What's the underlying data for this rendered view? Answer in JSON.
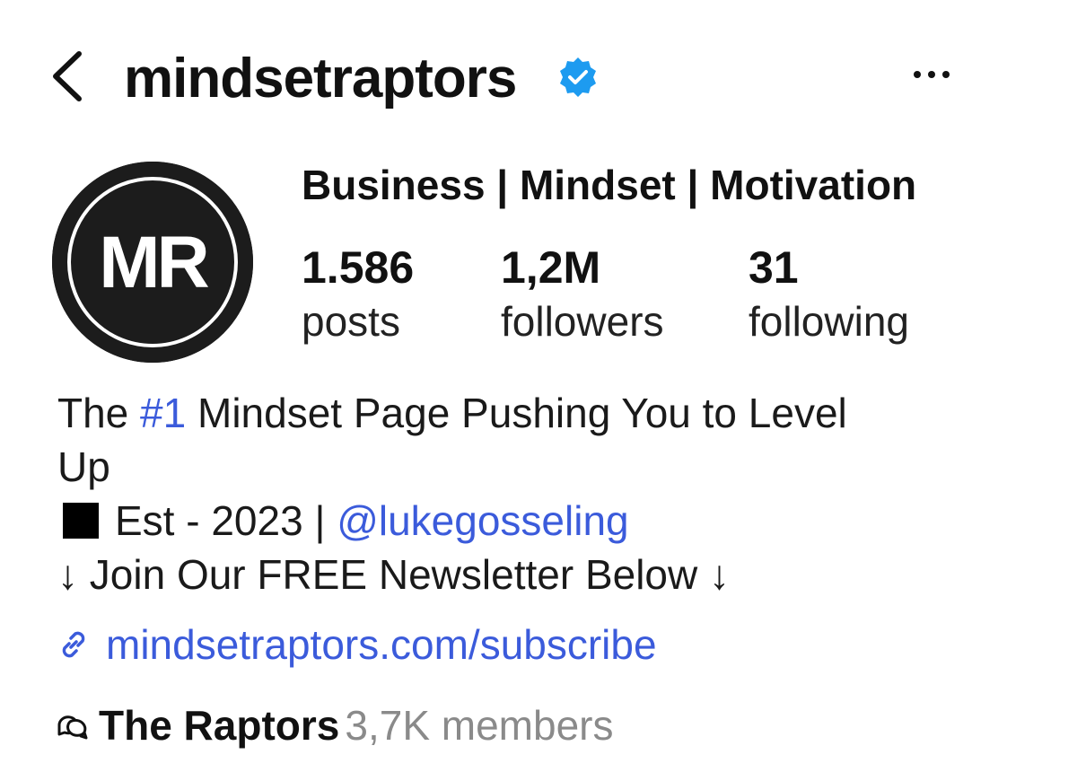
{
  "header": {
    "username": "mindsetraptors",
    "back_icon": "chevron-left-icon",
    "verified_icon": "verified-badge-icon",
    "more_icon": "more-horizontal-icon"
  },
  "profile": {
    "avatar_text": "MR",
    "category": "Business | Mindset | Motivation",
    "stats": {
      "posts": {
        "value": "1.586",
        "label": "posts"
      },
      "followers": {
        "value": "1,2M",
        "label": "followers"
      },
      "following": {
        "value": "31",
        "label": "following"
      }
    }
  },
  "bio": {
    "line1_prefix": "The ",
    "hashtag": "#1",
    "line1_suffix": " Mindset Page Pushing You to Level",
    "line2": "Up",
    "line3_prefix": "Est - 2023 | ",
    "mention": "@lukegosseling",
    "line4_arrow_left": "↓",
    "line4_text": " Join Our FREE Newsletter Below ",
    "line4_arrow_right": "↓"
  },
  "link": {
    "url": "mindsetraptors.com/subscribe",
    "icon": "link-icon"
  },
  "community": {
    "icon": "chat-bubbles-icon",
    "name": "The Raptors",
    "members": "3,7K members"
  },
  "colors": {
    "link": "#3b5bdb",
    "verified": "#1d9bf0",
    "avatar_bg": "#1c1c1c",
    "muted": "#8a8a8a"
  }
}
